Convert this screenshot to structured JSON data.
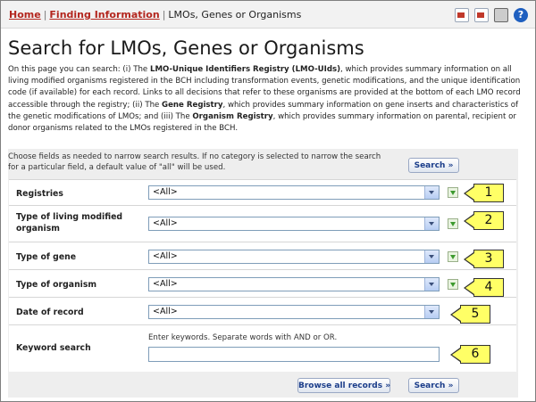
{
  "breadcrumb": {
    "home": "Home",
    "finding_information": "Finding Information",
    "current": "LMOs, Genes or Organisms"
  },
  "toolbar_icons": [
    "pdf-icon",
    "word-icon",
    "printer-icon",
    "help-icon"
  ],
  "help_glyph": "?",
  "page_title": "Search for LMOs, Genes or Organisms",
  "intro": {
    "p1": "On this page you can search: (i) The ",
    "b1": "LMO-Unique Identifiers Registry (LMO-UIds)",
    "p2": ", which provides summary information on all living modified organisms registered in the BCH including transformation events, genetic modifications, and the unique identification code (if available) for each record. Links to all decisions that refer to these organisms are provided at the bottom of each LMO record accessible through the registry; (ii) The ",
    "b2": "Gene Registry",
    "p3": ", which provides summary information on gene inserts and characteristics of the genetic modifications of LMOs; and (iii) The ",
    "b3": "Organism Registry",
    "p4": ", which provides summary information on parental, recipient or donor organisms related to the LMOs registered in the BCH."
  },
  "form": {
    "note": "Choose fields as needed to narrow search results. If no category is selected to narrow the search for a particular field, a default value of \"all\" will be used.",
    "search_label": "Search »",
    "browse_label": "Browse all records »",
    "fields": [
      {
        "label": "Registries",
        "value": "<All>",
        "callout": "1"
      },
      {
        "label": "Type of living modified organism",
        "value": "<All>",
        "callout": "2"
      },
      {
        "label": "Type of gene",
        "value": "<All>",
        "callout": "3"
      },
      {
        "label": "Type of organism",
        "value": "<All>",
        "callout": "4"
      },
      {
        "label": "Date of record",
        "value": "<All>",
        "callout": "5"
      }
    ],
    "keyword": {
      "label": "Keyword search",
      "hint": "Enter keywords. Separate words with AND or OR.",
      "value": "",
      "callout": "6"
    }
  },
  "colors": {
    "link_red": "#b3261e",
    "button_text": "#1b3d8a",
    "callout_yellow": "#ffff66",
    "form_background": "#eeeeee"
  }
}
